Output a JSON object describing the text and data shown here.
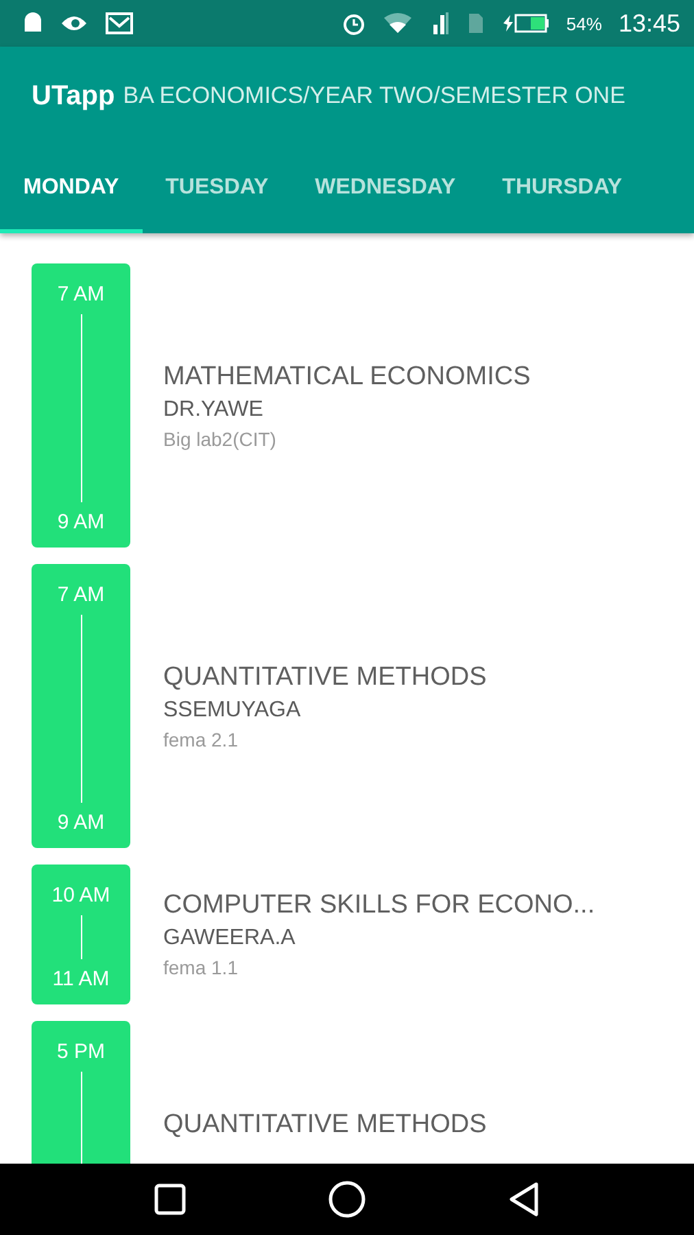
{
  "status_bar": {
    "battery": "54%",
    "time": "13:45"
  },
  "app_bar": {
    "title": "UTapp",
    "subtitle": "BA ECONOMICS/YEAR TWO/SEMESTER ONE"
  },
  "tabs": [
    {
      "label": "MONDAY",
      "selected": true
    },
    {
      "label": "TUESDAY",
      "selected": false
    },
    {
      "label": "WEDNESDAY",
      "selected": false
    },
    {
      "label": "THURSDAY",
      "selected": false
    }
  ],
  "classes": [
    {
      "kind": "long",
      "start": "7 AM",
      "end": "9 AM",
      "course": "MATHEMATICAL ECONOMICS",
      "lecturer": "DR.YAWE",
      "room": "Big lab2(CIT)"
    },
    {
      "kind": "long",
      "start": "7 AM",
      "end": "9 AM",
      "course": "QUANTITATIVE METHODS",
      "lecturer": "SSEMUYAGA",
      "room": "fema 2.1"
    },
    {
      "kind": "short",
      "start": "10 AM",
      "end": "11 AM",
      "course": "COMPUTER SKILLS FOR ECONO...",
      "lecturer": "GAWEERA.A",
      "room": "fema 1.1"
    },
    {
      "kind": "long",
      "start": "5 PM",
      "course": "QUANTITATIVE METHODS"
    }
  ]
}
